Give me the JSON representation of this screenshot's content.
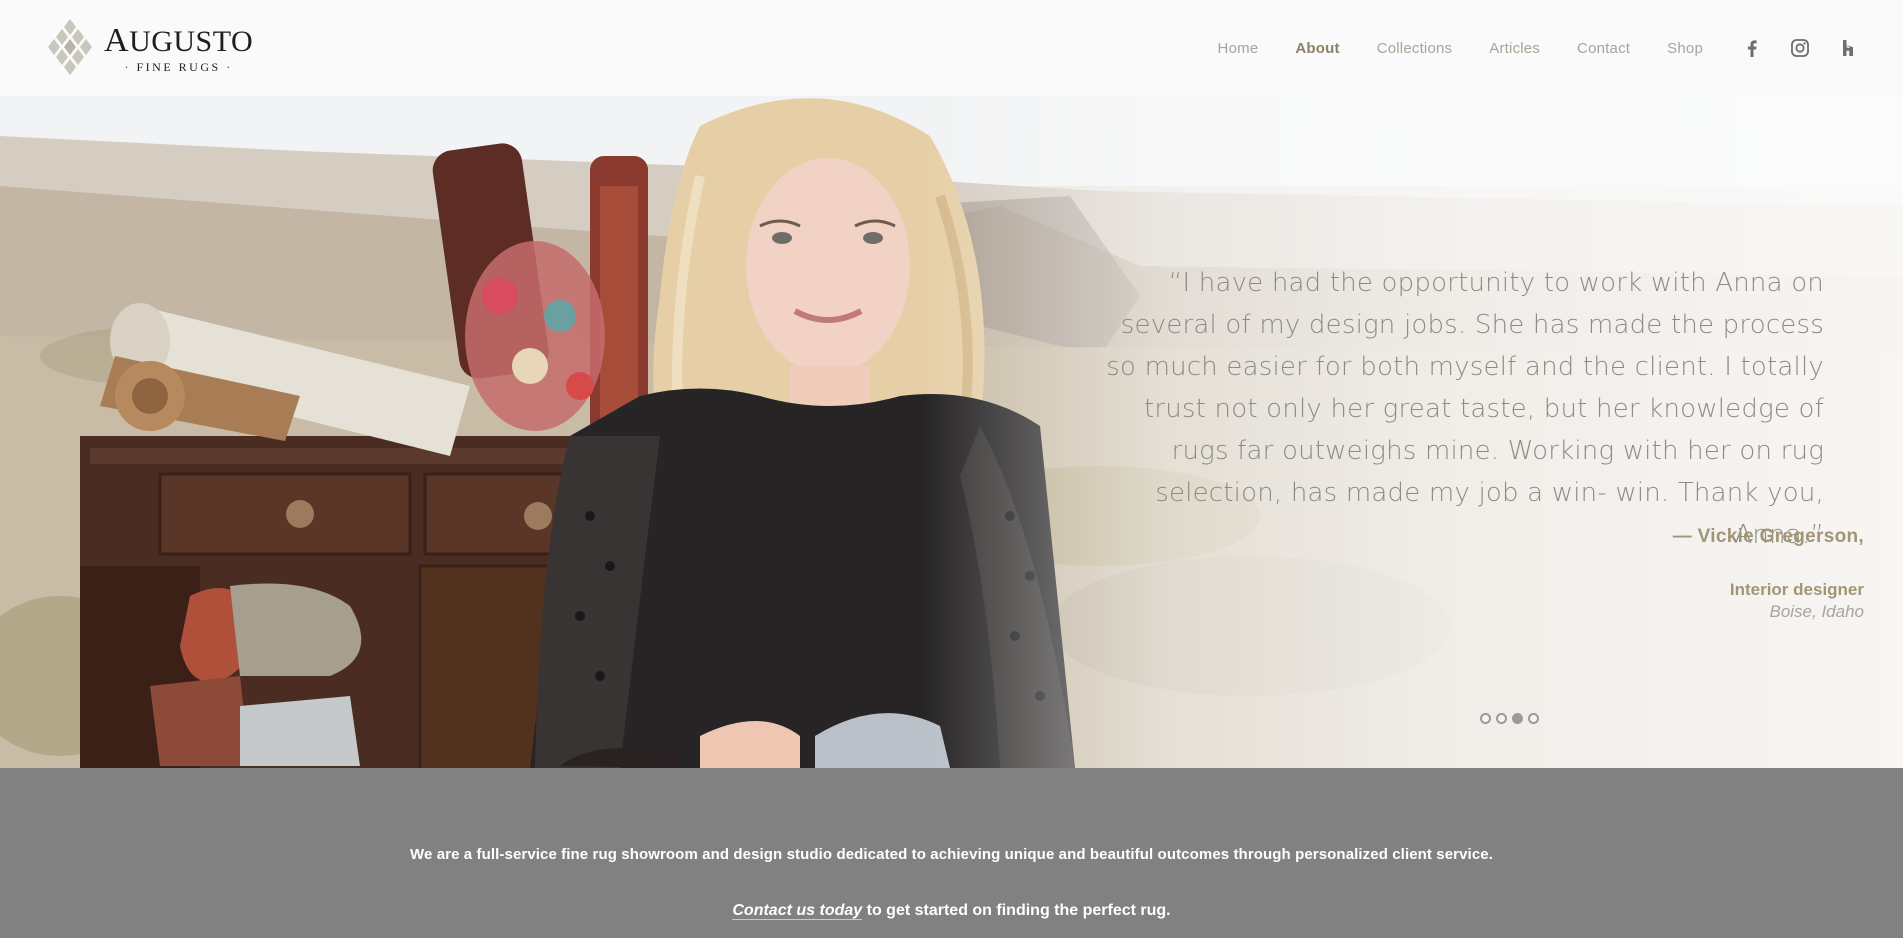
{
  "brand": {
    "name_cap": "A",
    "name_rest": "UGUSTO",
    "tagline": "· FINE RUGS ·"
  },
  "nav": {
    "items": [
      {
        "label": "Home",
        "active": false
      },
      {
        "label": "About",
        "active": true
      },
      {
        "label": "Collections",
        "active": false
      },
      {
        "label": "Articles",
        "active": false
      },
      {
        "label": "Contact",
        "active": false
      },
      {
        "label": "Shop",
        "active": false
      }
    ],
    "social": [
      "facebook-icon",
      "instagram-icon",
      "houzz-icon"
    ]
  },
  "testimonial": {
    "quote": "“I have had the opportunity to work with Anna on several of my design jobs. She has made the process so much easier for both myself and the client. I totally trust not only her great taste, but her knowledge of rugs far outweighs mine. Working with her on rug selection, has made my job a win- win. Thank you, Anna.”",
    "author": "— Vickie Gregerson,",
    "role": "Interior designer",
    "location": "Boise, Idaho",
    "slide_count": 4,
    "active_slide": 3
  },
  "intro": {
    "statement": "We are a full-service fine rug showroom and design studio dedicated to achieving unique and beautiful outcomes through personalized client service.",
    "cta_link": "Contact us today",
    "cta_rest": " to get started on finding the perfect rug."
  },
  "colors": {
    "nav_text": "#a7a498",
    "nav_active": "#8a8265",
    "accent_gold": "#a09575",
    "band_gray": "#818181"
  }
}
